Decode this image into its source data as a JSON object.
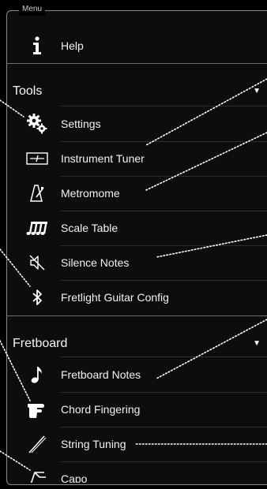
{
  "menu": {
    "legend": "Menu",
    "help_label": "Help",
    "tools_title": "Tools",
    "tools_arrow": "▼",
    "fretboard_title": "Fretboard",
    "fretboard_arrow": "▼",
    "tools_items": [
      {
        "label": "Settings",
        "icon": "gears-icon"
      },
      {
        "label": "Instrument Tuner",
        "icon": "tuner-icon"
      },
      {
        "label": "Metromome",
        "icon": "metronome-icon"
      },
      {
        "label": "Scale Table",
        "icon": "scale-table-icon"
      },
      {
        "label": "Silence Notes",
        "icon": "mute-speaker-icon"
      },
      {
        "label": "Fretlight Guitar Config",
        "icon": "bluetooth-icon"
      }
    ],
    "fretboard_items": [
      {
        "label": "Fretboard Notes",
        "icon": "music-note-icon"
      },
      {
        "label": "Chord Fingering",
        "icon": "hand-icon"
      },
      {
        "label": "String Tuning",
        "icon": "guitar-string-icon"
      },
      {
        "label": "Capo",
        "icon": "capo-icon"
      }
    ]
  }
}
